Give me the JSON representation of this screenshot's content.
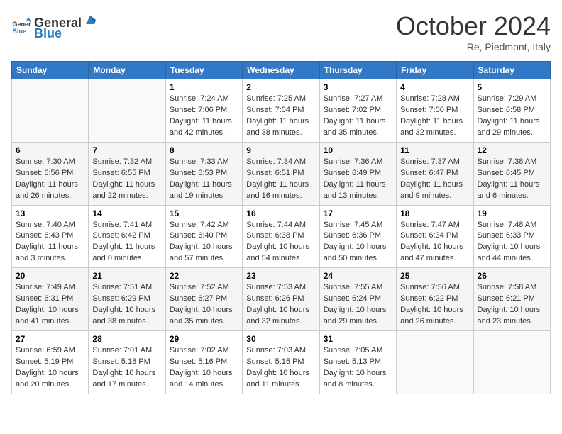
{
  "header": {
    "logo_general": "General",
    "logo_blue": "Blue",
    "month_title": "October 2024",
    "location": "Re, Piedmont, Italy"
  },
  "days_of_week": [
    "Sunday",
    "Monday",
    "Tuesday",
    "Wednesday",
    "Thursday",
    "Friday",
    "Saturday"
  ],
  "weeks": [
    [
      {
        "day": "",
        "info": ""
      },
      {
        "day": "",
        "info": ""
      },
      {
        "day": "1",
        "info": "Sunrise: 7:24 AM\nSunset: 7:06 PM\nDaylight: 11 hours and 42 minutes."
      },
      {
        "day": "2",
        "info": "Sunrise: 7:25 AM\nSunset: 7:04 PM\nDaylight: 11 hours and 38 minutes."
      },
      {
        "day": "3",
        "info": "Sunrise: 7:27 AM\nSunset: 7:02 PM\nDaylight: 11 hours and 35 minutes."
      },
      {
        "day": "4",
        "info": "Sunrise: 7:28 AM\nSunset: 7:00 PM\nDaylight: 11 hours and 32 minutes."
      },
      {
        "day": "5",
        "info": "Sunrise: 7:29 AM\nSunset: 6:58 PM\nDaylight: 11 hours and 29 minutes."
      }
    ],
    [
      {
        "day": "6",
        "info": "Sunrise: 7:30 AM\nSunset: 6:56 PM\nDaylight: 11 hours and 26 minutes."
      },
      {
        "day": "7",
        "info": "Sunrise: 7:32 AM\nSunset: 6:55 PM\nDaylight: 11 hours and 22 minutes."
      },
      {
        "day": "8",
        "info": "Sunrise: 7:33 AM\nSunset: 6:53 PM\nDaylight: 11 hours and 19 minutes."
      },
      {
        "day": "9",
        "info": "Sunrise: 7:34 AM\nSunset: 6:51 PM\nDaylight: 11 hours and 16 minutes."
      },
      {
        "day": "10",
        "info": "Sunrise: 7:36 AM\nSunset: 6:49 PM\nDaylight: 11 hours and 13 minutes."
      },
      {
        "day": "11",
        "info": "Sunrise: 7:37 AM\nSunset: 6:47 PM\nDaylight: 11 hours and 9 minutes."
      },
      {
        "day": "12",
        "info": "Sunrise: 7:38 AM\nSunset: 6:45 PM\nDaylight: 11 hours and 6 minutes."
      }
    ],
    [
      {
        "day": "13",
        "info": "Sunrise: 7:40 AM\nSunset: 6:43 PM\nDaylight: 11 hours and 3 minutes."
      },
      {
        "day": "14",
        "info": "Sunrise: 7:41 AM\nSunset: 6:42 PM\nDaylight: 11 hours and 0 minutes."
      },
      {
        "day": "15",
        "info": "Sunrise: 7:42 AM\nSunset: 6:40 PM\nDaylight: 10 hours and 57 minutes."
      },
      {
        "day": "16",
        "info": "Sunrise: 7:44 AM\nSunset: 6:38 PM\nDaylight: 10 hours and 54 minutes."
      },
      {
        "day": "17",
        "info": "Sunrise: 7:45 AM\nSunset: 6:36 PM\nDaylight: 10 hours and 50 minutes."
      },
      {
        "day": "18",
        "info": "Sunrise: 7:47 AM\nSunset: 6:34 PM\nDaylight: 10 hours and 47 minutes."
      },
      {
        "day": "19",
        "info": "Sunrise: 7:48 AM\nSunset: 6:33 PM\nDaylight: 10 hours and 44 minutes."
      }
    ],
    [
      {
        "day": "20",
        "info": "Sunrise: 7:49 AM\nSunset: 6:31 PM\nDaylight: 10 hours and 41 minutes."
      },
      {
        "day": "21",
        "info": "Sunrise: 7:51 AM\nSunset: 6:29 PM\nDaylight: 10 hours and 38 minutes."
      },
      {
        "day": "22",
        "info": "Sunrise: 7:52 AM\nSunset: 6:27 PM\nDaylight: 10 hours and 35 minutes."
      },
      {
        "day": "23",
        "info": "Sunrise: 7:53 AM\nSunset: 6:26 PM\nDaylight: 10 hours and 32 minutes."
      },
      {
        "day": "24",
        "info": "Sunrise: 7:55 AM\nSunset: 6:24 PM\nDaylight: 10 hours and 29 minutes."
      },
      {
        "day": "25",
        "info": "Sunrise: 7:56 AM\nSunset: 6:22 PM\nDaylight: 10 hours and 26 minutes."
      },
      {
        "day": "26",
        "info": "Sunrise: 7:58 AM\nSunset: 6:21 PM\nDaylight: 10 hours and 23 minutes."
      }
    ],
    [
      {
        "day": "27",
        "info": "Sunrise: 6:59 AM\nSunset: 5:19 PM\nDaylight: 10 hours and 20 minutes."
      },
      {
        "day": "28",
        "info": "Sunrise: 7:01 AM\nSunset: 5:18 PM\nDaylight: 10 hours and 17 minutes."
      },
      {
        "day": "29",
        "info": "Sunrise: 7:02 AM\nSunset: 5:16 PM\nDaylight: 10 hours and 14 minutes."
      },
      {
        "day": "30",
        "info": "Sunrise: 7:03 AM\nSunset: 5:15 PM\nDaylight: 10 hours and 11 minutes."
      },
      {
        "day": "31",
        "info": "Sunrise: 7:05 AM\nSunset: 5:13 PM\nDaylight: 10 hours and 8 minutes."
      },
      {
        "day": "",
        "info": ""
      },
      {
        "day": "",
        "info": ""
      }
    ]
  ]
}
